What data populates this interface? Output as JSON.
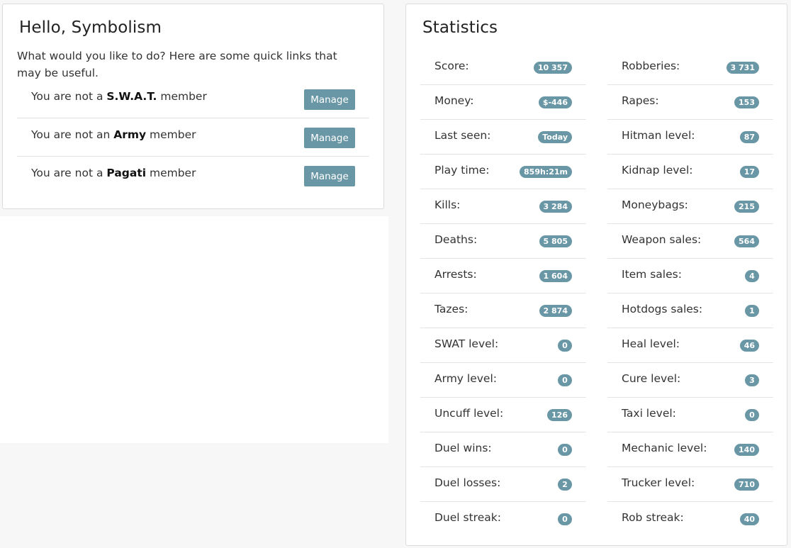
{
  "welcome": {
    "title": "Hello, Symbolism",
    "intro": "What would you like to do? Here are some quick links that may be useful.",
    "memberships": [
      {
        "prefix": "You are not a ",
        "group": "S.W.A.T.",
        "suffix": " member",
        "button": "Manage"
      },
      {
        "prefix": "You are not an ",
        "group": "Army",
        "suffix": " member",
        "button": "Manage"
      },
      {
        "prefix": "You are not a ",
        "group": "Pagati",
        "suffix": " member",
        "button": "Manage"
      }
    ]
  },
  "statistics": {
    "title": "Statistics",
    "left": [
      {
        "label": "Score:",
        "value": "10 357"
      },
      {
        "label": "Money:",
        "value": "$-446"
      },
      {
        "label": "Last seen:",
        "value": "Today"
      },
      {
        "label": "Play time:",
        "value": "859h:21m"
      },
      {
        "label": "Kills:",
        "value": "3 284"
      },
      {
        "label": "Deaths:",
        "value": "5 805"
      },
      {
        "label": "Arrests:",
        "value": "1 604"
      },
      {
        "label": "Tazes:",
        "value": "2 874"
      },
      {
        "label": "SWAT level:",
        "value": "0"
      },
      {
        "label": "Army level:",
        "value": "0"
      },
      {
        "label": "Uncuff level:",
        "value": "126"
      },
      {
        "label": "Duel wins:",
        "value": "0"
      },
      {
        "label": "Duel losses:",
        "value": "2"
      },
      {
        "label": "Duel streak:",
        "value": "0"
      }
    ],
    "right": [
      {
        "label": "Robberies:",
        "value": "3 731"
      },
      {
        "label": "Rapes:",
        "value": "153"
      },
      {
        "label": "Hitman level:",
        "value": "87"
      },
      {
        "label": "Kidnap level:",
        "value": "17"
      },
      {
        "label": "Moneybags:",
        "value": "215"
      },
      {
        "label": "Weapon sales:",
        "value": "564"
      },
      {
        "label": "Item sales:",
        "value": "4"
      },
      {
        "label": "Hotdogs sales:",
        "value": "1"
      },
      {
        "label": "Heal level:",
        "value": "46"
      },
      {
        "label": "Cure level:",
        "value": "3"
      },
      {
        "label": "Taxi level:",
        "value": "0"
      },
      {
        "label": "Mechanic level:",
        "value": "140"
      },
      {
        "label": "Trucker level:",
        "value": "710"
      },
      {
        "label": "Rob streak:",
        "value": "40"
      }
    ]
  },
  "colors": {
    "accent": "#6a97a6",
    "background": "#f7f7f7",
    "card": "#ffffff"
  }
}
